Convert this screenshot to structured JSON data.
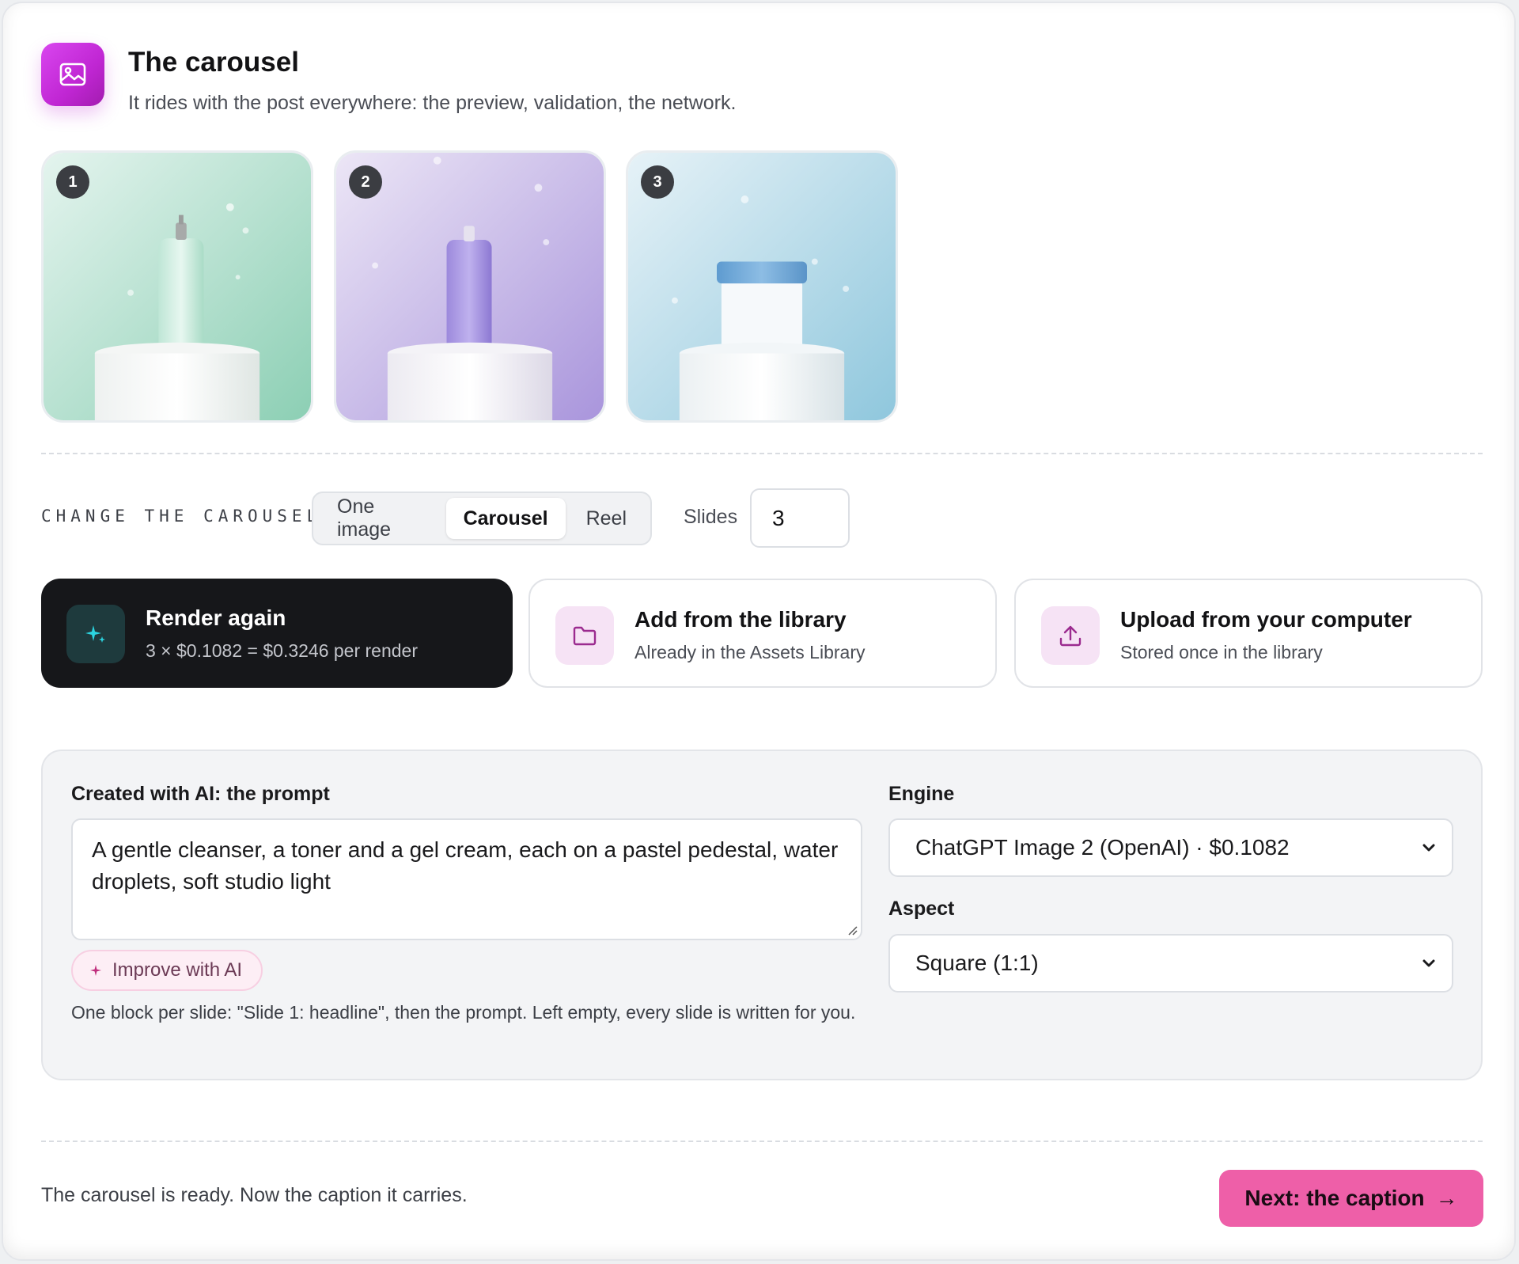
{
  "header": {
    "title": "The carousel",
    "subtitle": "It rides with the post everywhere: the preview, validation, the network.",
    "icon": "image-icon",
    "accent": "#c026d3"
  },
  "slides_preview": [
    {
      "number": "1",
      "color": "#8ccfb4"
    },
    {
      "number": "2",
      "color": "#a995dc"
    },
    {
      "number": "3",
      "color": "#8fc7dd"
    }
  ],
  "change": {
    "label": "CHANGE THE CAROUSEL",
    "modes": [
      "One image",
      "Carousel",
      "Reel"
    ],
    "active_mode": "Carousel",
    "slides_label": "Slides",
    "slides_value": "3"
  },
  "actions": {
    "render": {
      "title": "Render again",
      "subtitle": "3 × $0.1082 = $0.3246 per render",
      "icon": "sparkle-icon"
    },
    "library": {
      "title": "Add from the library",
      "subtitle": "Already in the Assets Library",
      "icon": "folder-icon"
    },
    "upload": {
      "title": "Upload from your computer",
      "subtitle": "Stored once in the library",
      "icon": "upload-icon"
    }
  },
  "prompt_panel": {
    "prompt_label": "Created with AI: the prompt",
    "prompt_value": "A gentle cleanser, a toner and a gel cream, each on a pastel pedestal, water droplets, soft studio light",
    "improve_label": "Improve with AI",
    "hint": "One block per slide: \"Slide 1: headline\", then the prompt. Left empty, every slide is written for you.",
    "engine_label": "Engine",
    "engine_value": "ChatGPT Image 2 (OpenAI) · $0.1082",
    "aspect_label": "Aspect",
    "aspect_value": "Square (1:1)"
  },
  "footer": {
    "status": "The carousel is ready. Now the caption it carries.",
    "next_label": "Next: the caption",
    "next_arrow": "→",
    "next_color": "#ee5fa8"
  }
}
